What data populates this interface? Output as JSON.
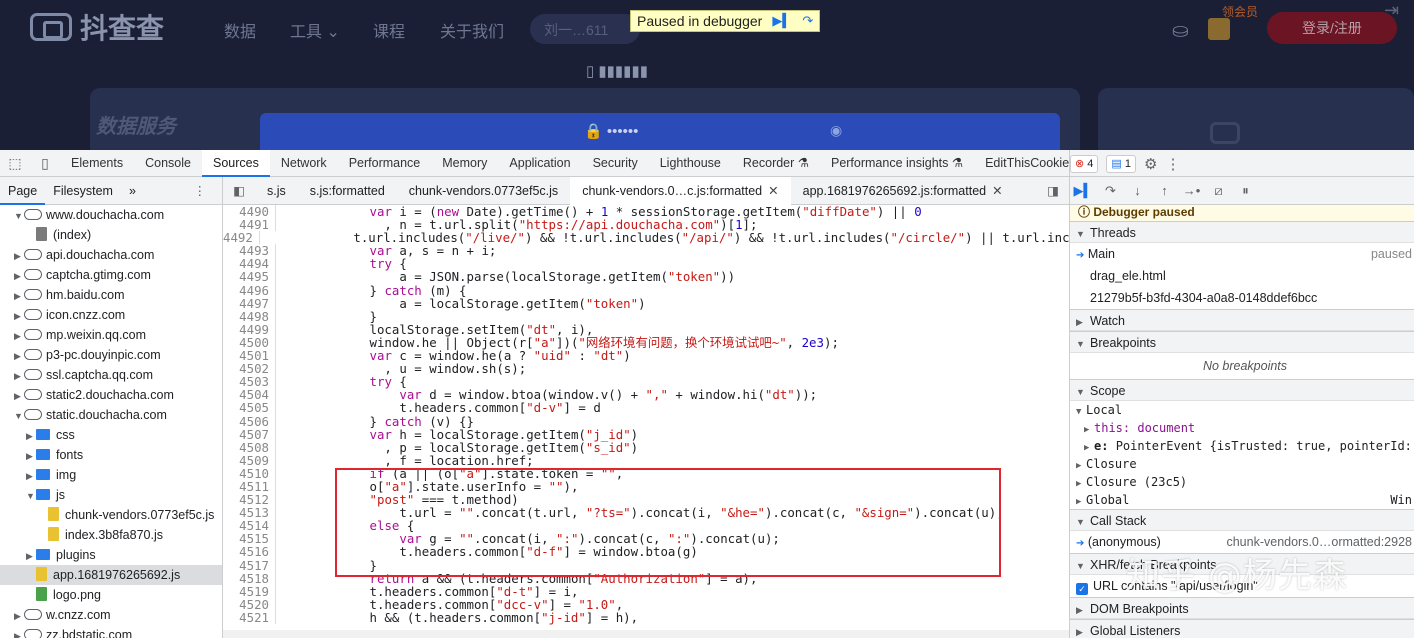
{
  "site": {
    "logo_text": "抖查查",
    "nav": [
      "数据",
      "工具 ⌄",
      "课程",
      "关于我们"
    ],
    "search_text": "刘一…611",
    "phone_label": "▯",
    "vip_label": "领会员",
    "login_label": "登录/注册",
    "service_label": "数据服务",
    "password_mask": "••••••"
  },
  "debug_banner": {
    "text": "Paused in debugger"
  },
  "devtools": {
    "tabs": [
      "Elements",
      "Console",
      "Sources",
      "Network",
      "Performance",
      "Memory",
      "Application",
      "Security",
      "Lighthouse",
      "Recorder ⚗",
      "Performance insights ⚗",
      "EditThisCookie"
    ],
    "active_tab": "Sources",
    "error_count": "4",
    "message_count": "1"
  },
  "navigator": {
    "tabs": [
      "Page",
      "Filesystem",
      "»"
    ],
    "tree": [
      {
        "label": "www.douchacha.com",
        "depth": 0,
        "type": "cloud",
        "open": true
      },
      {
        "label": "(index)",
        "depth": 1,
        "type": "file"
      },
      {
        "label": "api.douchacha.com",
        "depth": 0,
        "type": "cloud"
      },
      {
        "label": "captcha.gtimg.com",
        "depth": 0,
        "type": "cloud"
      },
      {
        "label": "hm.baidu.com",
        "depth": 0,
        "type": "cloud"
      },
      {
        "label": "icon.cnzz.com",
        "depth": 0,
        "type": "cloud"
      },
      {
        "label": "mp.weixin.qq.com",
        "depth": 0,
        "type": "cloud"
      },
      {
        "label": "p3-pc.douyinpic.com",
        "depth": 0,
        "type": "cloud"
      },
      {
        "label": "ssl.captcha.qq.com",
        "depth": 0,
        "type": "cloud"
      },
      {
        "label": "static2.douchacha.com",
        "depth": 0,
        "type": "cloud"
      },
      {
        "label": "static.douchacha.com",
        "depth": 0,
        "type": "cloud",
        "open": true
      },
      {
        "label": "css",
        "depth": 1,
        "type": "folder"
      },
      {
        "label": "fonts",
        "depth": 1,
        "type": "folder"
      },
      {
        "label": "img",
        "depth": 1,
        "type": "folder"
      },
      {
        "label": "js",
        "depth": 1,
        "type": "folder",
        "open": true
      },
      {
        "label": "chunk-vendors.0773ef5c.js",
        "depth": 2,
        "type": "js"
      },
      {
        "label": "index.3b8fa870.js",
        "depth": 2,
        "type": "js"
      },
      {
        "label": "plugins",
        "depth": 1,
        "type": "folder"
      },
      {
        "label": "app.1681976265692.js",
        "depth": 1,
        "type": "js",
        "selected": true
      },
      {
        "label": "logo.png",
        "depth": 1,
        "type": "png"
      },
      {
        "label": "w.cnzz.com",
        "depth": 0,
        "type": "cloud"
      },
      {
        "label": "zz.bdstatic.com",
        "depth": 0,
        "type": "cloud"
      }
    ]
  },
  "editor": {
    "tabs": [
      {
        "label": "s.js",
        "closable": false
      },
      {
        "label": "s.js:formatted",
        "closable": false
      },
      {
        "label": "chunk-vendors.0773ef5c.js",
        "closable": false
      },
      {
        "label": "chunk-vendors.0…c.js:formatted",
        "closable": true,
        "active": true
      },
      {
        "label": "app.1681976265692.js:formatted",
        "closable": true
      }
    ],
    "lines": [
      {
        "n": "4490",
        "code": "            var i = (new Date).getTime() + 1 * sessionStorage.getItem(\"diffDate\") || 0"
      },
      {
        "n": "4491",
        "code": "              , n = t.url.split(\"https://api.douchacha.com\")[1];"
      },
      {
        "n": "4492",
        "code": "            t.url.includes(\"/live/\") && !t.url.includes(\"/api/\") && !t.url.includes(\"/circle/\") || t.url.incl"
      },
      {
        "n": "4493",
        "code": "            var a, s = n + i;"
      },
      {
        "n": "4494",
        "code": "            try {"
      },
      {
        "n": "4495",
        "code": "                a = JSON.parse(localStorage.getItem(\"token\"))"
      },
      {
        "n": "4496",
        "code": "            } catch (m) {"
      },
      {
        "n": "4497",
        "code": "                a = localStorage.getItem(\"token\")"
      },
      {
        "n": "4498",
        "code": "            }"
      },
      {
        "n": "4499",
        "code": "            localStorage.setItem(\"dt\", i),"
      },
      {
        "n": "4500",
        "code": "            window.he || Object(r[\"a\"])(\"网络环境有问题，换个环境试试吧~\", 2e3);"
      },
      {
        "n": "4501",
        "code": "            var c = window.he(a ? \"uid\" : \"dt\")"
      },
      {
        "n": "4502",
        "code": "              , u = window.sh(s);"
      },
      {
        "n": "4503",
        "code": "            try {"
      },
      {
        "n": "4504",
        "code": "                var d = window.btoa(window.v() + \",\" + window.hi(\"dt\"));"
      },
      {
        "n": "4505",
        "code": "                t.headers.common[\"d-v\"] = d"
      },
      {
        "n": "4506",
        "code": "            } catch (v) {}"
      },
      {
        "n": "4507",
        "code": "            var h = localStorage.getItem(\"j_id\")"
      },
      {
        "n": "4508",
        "code": "              , p = localStorage.getItem(\"s_id\")"
      },
      {
        "n": "4509",
        "code": "              , f = location.href;"
      },
      {
        "n": "4510",
        "code": "            if (a || (o[\"a\"].state.token = \"\","
      },
      {
        "n": "4511",
        "code": "            o[\"a\"].state.userInfo = \"\"),"
      },
      {
        "n": "4512",
        "code": "            \"post\" === t.method)"
      },
      {
        "n": "4513",
        "code": "                t.url = \"\".concat(t.url, \"?ts=\").concat(i, \"&he=\").concat(c, \"&sign=\").concat(u);"
      },
      {
        "n": "4514",
        "code": "            else {"
      },
      {
        "n": "4515",
        "code": "                var g = \"\".concat(i, \":\").concat(c, \":\").concat(u);"
      },
      {
        "n": "4516",
        "code": "                t.headers.common[\"d-f\"] = window.btoa(g)"
      },
      {
        "n": "4517",
        "code": "            }"
      },
      {
        "n": "4518",
        "code": "            return a && (t.headers.common[\"Authorization\"] = a),"
      },
      {
        "n": "4519",
        "code": "            t.headers.common[\"d-t\"] = i,"
      },
      {
        "n": "4520",
        "code": "            t.headers.common[\"dcc-v\"] = \"1.0\","
      },
      {
        "n": "4521",
        "code": "            h && (t.headers.common[\"j-id\"] = h),"
      }
    ]
  },
  "debugger": {
    "paused_label": "Debugger paused",
    "threads_label": "Threads",
    "threads": [
      {
        "name": "Main",
        "status": "paused",
        "current": true
      },
      {
        "name": "drag_ele.html"
      },
      {
        "name": "21279b5f-b3fd-4304-a0a8-0148ddef6bcc"
      }
    ],
    "watch_label": "Watch",
    "breakpoints_label": "Breakpoints",
    "no_breakpoints": "No breakpoints",
    "scope_label": "Scope",
    "local_label": "Local",
    "scope_this_key": "this:",
    "scope_this_val": "document",
    "scope_e_key": "e:",
    "scope_e_val": "PointerEvent {isTrusted: true, pointerId:",
    "scope_closure": "Closure",
    "scope_closure2": "Closure (23c5)",
    "scope_global": "Global",
    "scope_global_val": "Win",
    "call_stack_label": "Call Stack",
    "call_frame": "(anonymous)",
    "call_frame_loc": "chunk-vendors.0…ormatted:2928",
    "xhr_label": "XHR/fetch Breakpoints",
    "xhr_item": "URL contains \"/api/user/login\"",
    "dom_bp_label": "DOM Breakpoints",
    "global_listeners_label": "Global Listeners"
  },
  "watermark": "知乎 @杨先森"
}
